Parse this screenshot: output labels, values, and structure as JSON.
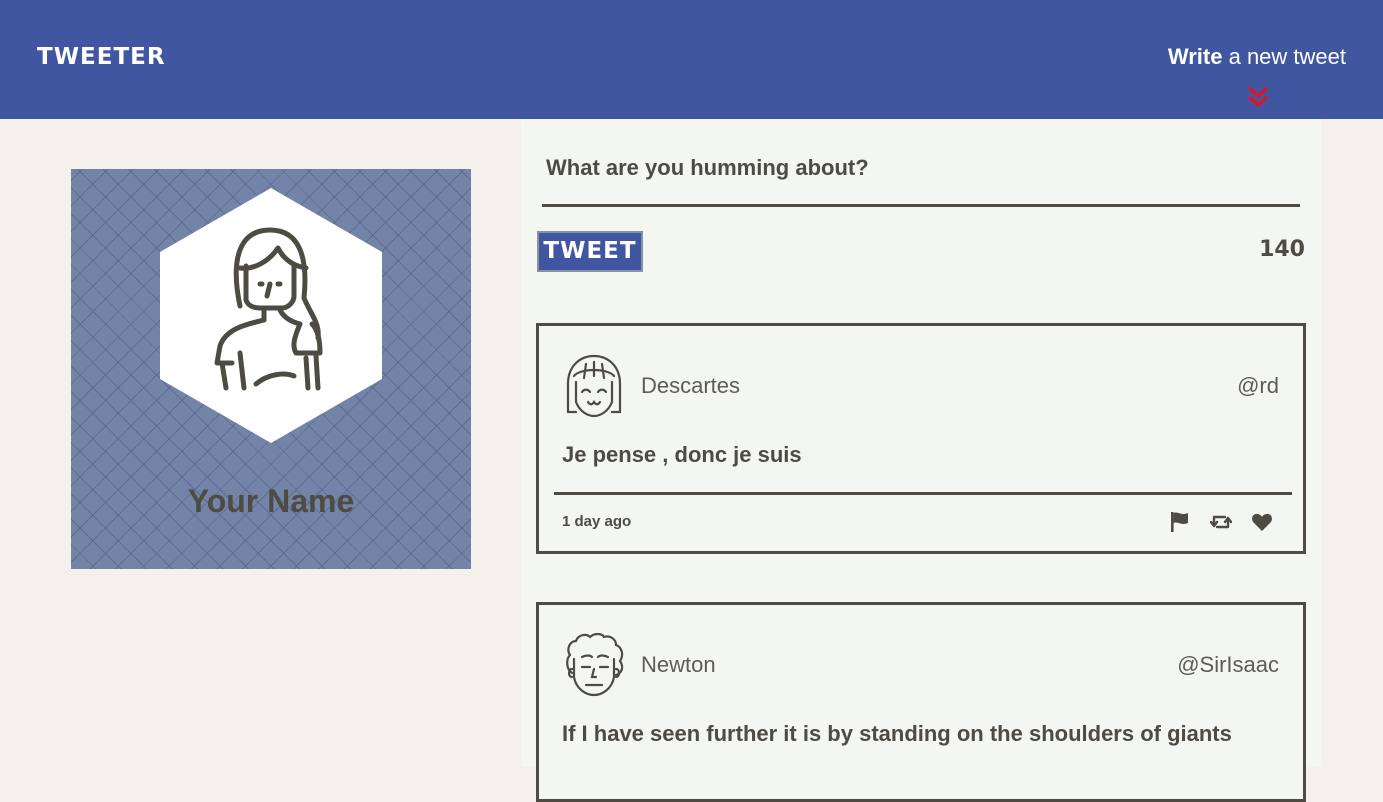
{
  "nav": {
    "brand": "TWEETER",
    "compose_bold": "Write",
    "compose_rest": "a new tweet"
  },
  "profile": {
    "name": "Your Name"
  },
  "composer": {
    "placeholder": "What are you humming about?",
    "button_label": "TWEET",
    "counter": "140"
  },
  "tweets": [
    {
      "author": "Descartes",
      "handle": "@rd",
      "text": "Je pense , donc je suis",
      "timestamp": "1 day ago"
    },
    {
      "author": "Newton",
      "handle": "@SirIsaac",
      "text": "If I have seen further it is by standing on the shoulders of giants"
    }
  ],
  "icons": {
    "compose_toggle": "double-chevron-down-icon",
    "flag": "flag-icon",
    "retweet": "retweet-icon",
    "like": "heart-icon"
  },
  "colors": {
    "nav_bg": "#4056a1",
    "accent_red": "#e0131f",
    "text_dark": "#4d4b42",
    "page_bg": "#f4f1ed",
    "card_bg": "#7384a8"
  }
}
